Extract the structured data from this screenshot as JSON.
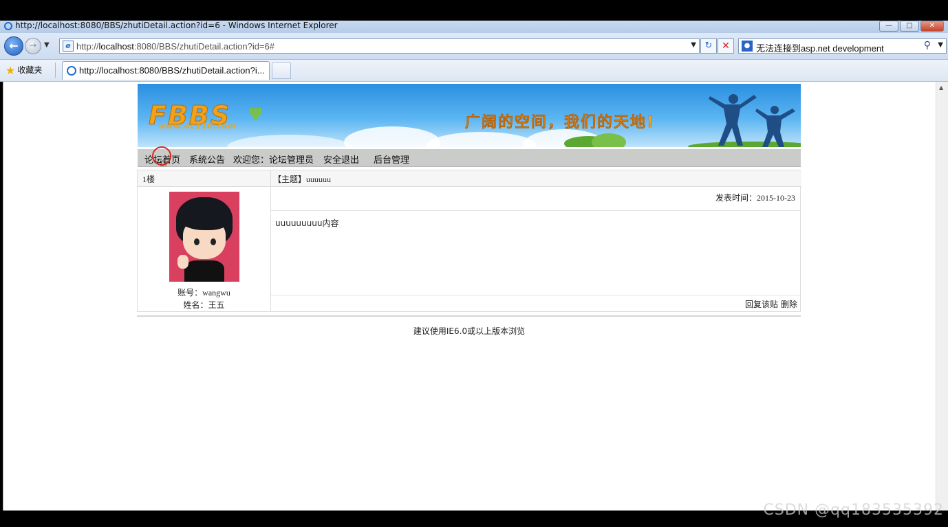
{
  "window": {
    "title": "http://localhost:8080/BBS/zhutiDetail.action?id=6 - Windows Internet Explorer",
    "controls": [
      "minimize",
      "maximize",
      "close"
    ]
  },
  "navbar": {
    "address_prefix": "http://",
    "address_host": "localhost",
    "address_rest": ":8080/BBS/zhutiDetail.action?id=6#",
    "search_text": "无法连接到asp.net development"
  },
  "favorites": {
    "label": "收藏夹",
    "tab_title": "http://localhost:8080/BBS/zhutiDetail.action?i..."
  },
  "site": {
    "logo": "FBBS",
    "logo_sub": "www.ec110.com",
    "slogan": "广阔的空间，我们的天地!",
    "menu": {
      "home": "论坛首页",
      "notice": "系统公告",
      "welcome": "欢迎您：论坛管理员",
      "logout": "安全退出",
      "admin": "后台管理"
    }
  },
  "post": {
    "floor": "1楼",
    "subject": "【主题】uuuuuu",
    "time_label": "发表时间：",
    "time_value": "2015-10-23",
    "body": "uuuuuuuuu内容",
    "account_label": "账号：",
    "account_value": "wangwu",
    "name_label": "姓名：",
    "name_value": "王五",
    "reply": "回复该贴",
    "delete": "删除"
  },
  "footer": {
    "text": "建议使用IE6.0或以上版本浏览"
  },
  "watermark": "CSDN @qq183535392",
  "colors": {
    "menubar_bg": "#c9ccc9",
    "banner_sky": "#2b8fe0",
    "logo_orange": "#f2a21a"
  }
}
